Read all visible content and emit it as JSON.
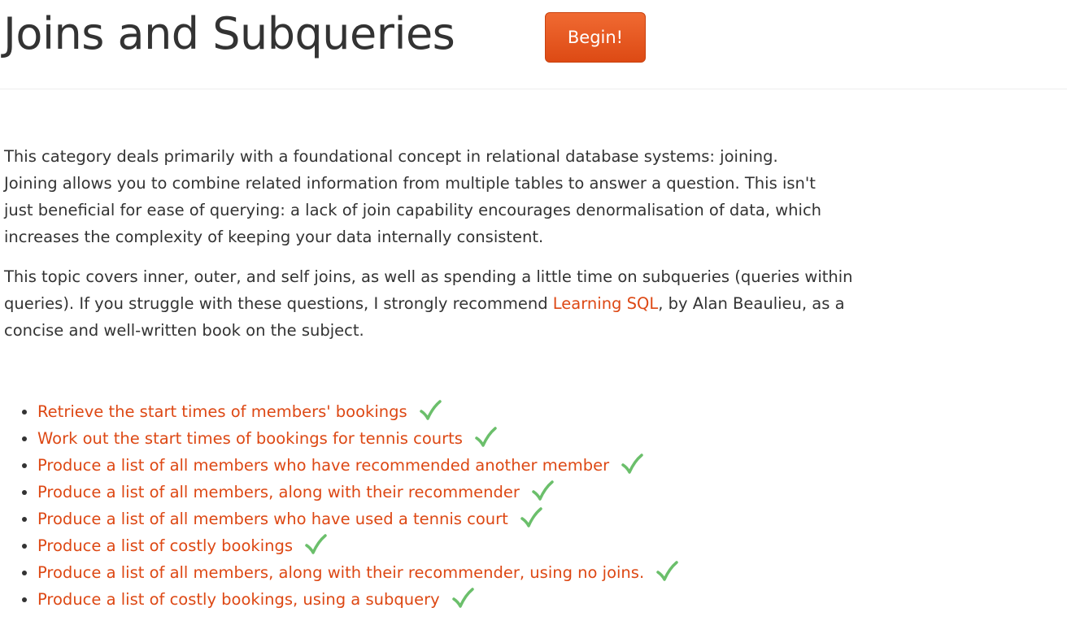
{
  "header": {
    "title": "Joins and Subqueries",
    "begin_label": "Begin!"
  },
  "intro": {
    "paragraph1": "This category deals primarily with a foundational concept in relational database systems: joining. Joining allows you to combine related information from multiple tables to answer a question. This isn't just beneficial for ease of querying: a lack of join capability encourages denormalisation of data, which increases the complexity of keeping your data internally consistent.",
    "paragraph2_before": "This topic covers inner, outer, and self joins, as well as spending a little time on subqueries (queries within queries). If you struggle with these questions, I strongly recommend ",
    "paragraph2_link": "Learning SQL",
    "paragraph2_after": ", by Alan Beaulieu, as a concise and well-written book on the subject."
  },
  "exercises": [
    {
      "label": "Retrieve the start times of members' bookings",
      "completed": true,
      "status_icon": "check-icon"
    },
    {
      "label": "Work out the start times of bookings for tennis courts",
      "completed": true,
      "status_icon": "check-icon"
    },
    {
      "label": "Produce a list of all members who have recommended another member",
      "completed": true,
      "status_icon": "check-icon"
    },
    {
      "label": "Produce a list of all members, along with their recommender",
      "completed": true,
      "status_icon": "check-icon"
    },
    {
      "label": "Produce a list of all members who have used a tennis court",
      "completed": true,
      "status_icon": "check-icon"
    },
    {
      "label": "Produce a list of costly bookings",
      "completed": true,
      "status_icon": "check-icon"
    },
    {
      "label": "Produce a list of all members, along with their recommender, using no joins.",
      "completed": true,
      "status_icon": "check-icon"
    },
    {
      "label": "Produce a list of costly bookings, using a subquery",
      "completed": true,
      "status_icon": "check-icon"
    }
  ],
  "colors": {
    "accent": "#dd4814",
    "text": "#333333",
    "check": "#6bbf6b"
  }
}
